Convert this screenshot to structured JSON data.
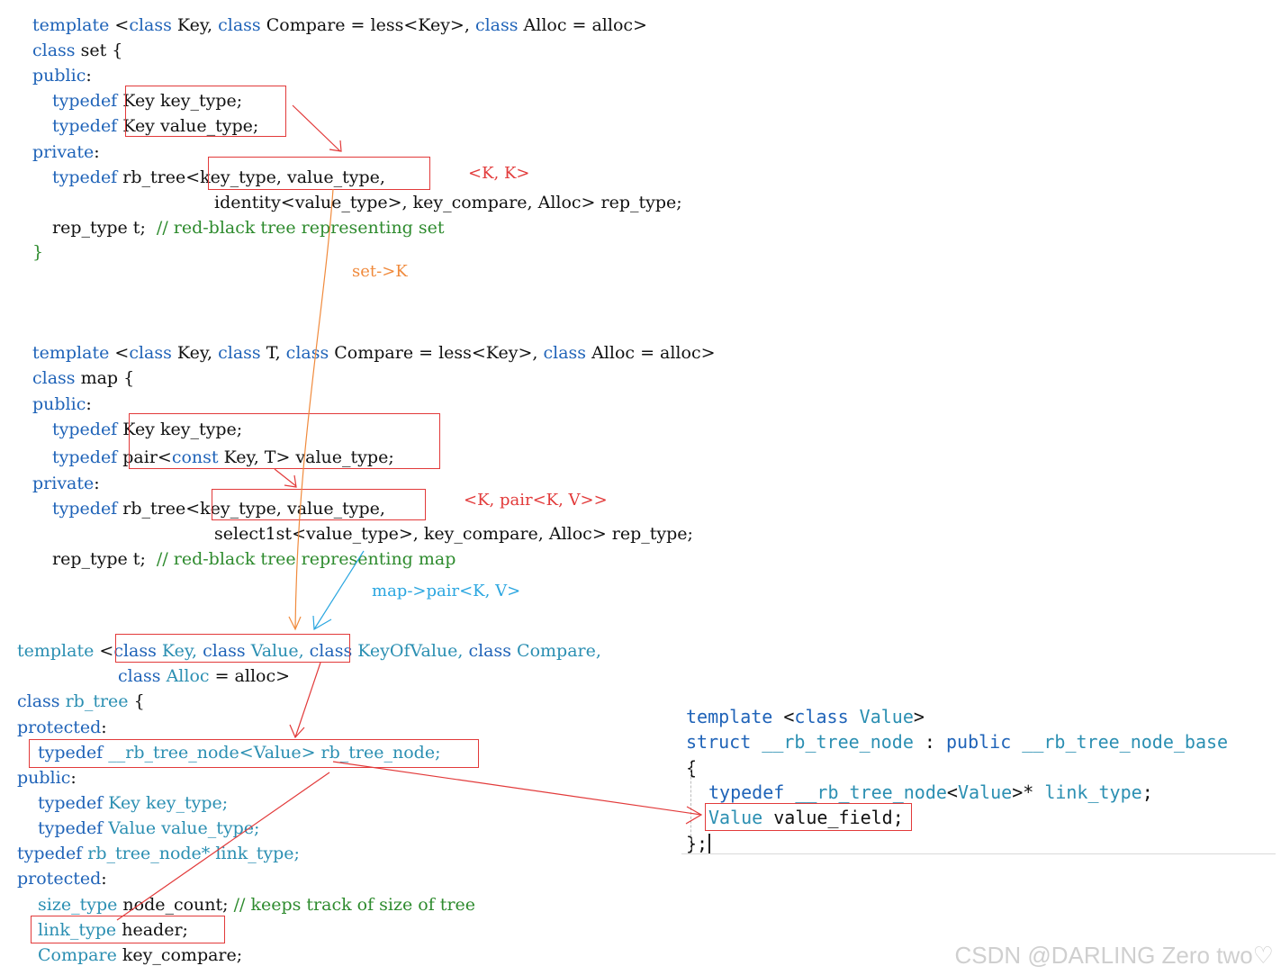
{
  "set_block": {
    "l1": {
      "a": "template",
      "b": " <",
      "c": "class",
      "d": " Key, ",
      "e": "class",
      "f": " Compare = less<Key>, ",
      "g": "class",
      "h": " Alloc = alloc>"
    },
    "l2": {
      "a": "class",
      "b": " set {"
    },
    "l3": {
      "a": "public",
      "b": ":"
    },
    "l4": {
      "a": "typedef",
      "b": " Key key_type;"
    },
    "l5": {
      "a": "typedef",
      "b": " Key value_type;"
    },
    "l6": {
      "a": "private",
      "b": ":"
    },
    "l7": {
      "a": "typedef",
      "b": " rb_tree<key_type, value_type,"
    },
    "l8": {
      "a": "identity<value_type>, key_compare, Alloc> rep_type;"
    },
    "l9": {
      "a": "rep_type t;  ",
      "b": "// red-black tree representing set"
    },
    "l10": {
      "a": "}"
    }
  },
  "map_block": {
    "l1": {
      "a": "template",
      "b": " <",
      "c": "class",
      "d": " Key, ",
      "e": "class",
      "f": " T, ",
      "g": "class",
      "h": " Compare = less<Key>, ",
      "i": "class",
      "j": " Alloc = alloc>"
    },
    "l2": {
      "a": "class",
      "b": " map {"
    },
    "l3": {
      "a": "public",
      "b": ":"
    },
    "l4": {
      "a": "typedef",
      "b": " Key key_type;"
    },
    "l5": {
      "a": "typedef",
      "b": " pair<",
      "c": "const",
      "d": " Key, T> value_type;"
    },
    "l6": {
      "a": "private",
      "b": ":"
    },
    "l7": {
      "a": "typedef",
      "b": " rb_tree<key_type, value_type,"
    },
    "l8": {
      "a": "select1st<value_type>, key_compare, Alloc> rep_type;"
    },
    "l9": {
      "a": "rep_type t;  ",
      "b": "// red-black tree representing map"
    }
  },
  "rb_block": {
    "l1": {
      "a": "template",
      "b": " <",
      "c": "class",
      "d": " Key, ",
      "e": "class",
      "f": " Value, ",
      "g": "class",
      "h": " KeyOfValue, ",
      "i": "class",
      "j": " Compare,"
    },
    "l2": {
      "a": "class",
      "b": " Alloc",
      "c": " = alloc>"
    },
    "l3": {
      "a": "class",
      "b": " rb_tree",
      "c": " {"
    },
    "l4": {
      "a": "protected",
      "b": ":"
    },
    "l5": {
      "a": "typedef",
      "b": " __rb_tree_node<Value> rb_tree_node;"
    },
    "l6": {
      "a": "public",
      "b": ":"
    },
    "l7": {
      "a": "typedef",
      "b": " Key key_type;"
    },
    "l8": {
      "a": "typedef",
      "b": " Value value_type;"
    },
    "l9": {
      "a": "typedef",
      "b": " rb_tree_node* ",
      "c": "link_type;"
    },
    "l10": {
      "a": "protected",
      "b": ":"
    },
    "l11": {
      "a": "size_type",
      "b": " node_count; ",
      "c": "// keeps track of size of tree"
    },
    "l12": {
      "a": "link_type",
      "b": " header;"
    },
    "l13": {
      "a": "Compare",
      "b": " key_compare;"
    }
  },
  "node_block": {
    "l1": {
      "a": "template",
      "b": " <",
      "c": "class",
      "d": " Value",
      "e": ">"
    },
    "l2": {
      "a": "struct",
      "b": " __rb_tree_node",
      "c": " : ",
      "d": "public",
      "e": " __rb_tree_node_base"
    },
    "l3": {
      "a": "{"
    },
    "l4": {
      "a": "typedef",
      "b": " __rb_tree_node",
      "c": "<",
      "d": "Value",
      "e": ">* ",
      "f": "link_type",
      ";": ";",
      "g": ";"
    },
    "l5": {
      "a": "Value",
      "b": " value_field;"
    },
    "l6": {
      "a": "};"
    }
  },
  "annotations": {
    "set_kk": "<K, K>",
    "set_to_k": "set->K",
    "map_kv": "<K, pair<K, V>>",
    "map_to_pair": "map->pair<K, V>"
  },
  "watermark": "CSDN @DARLING Zero two♡",
  "colors": {
    "keyword": "#1f63b8",
    "type": "#2b8fb2",
    "comment": "#2e8b2e",
    "highlight": "#e23a3a",
    "orange": "#f08a3c",
    "blue": "#2aa6e0"
  }
}
